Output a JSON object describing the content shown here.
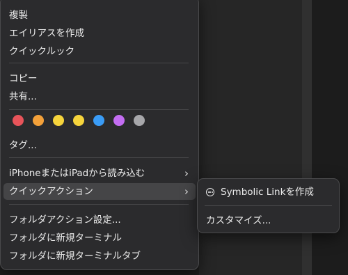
{
  "menu": {
    "items_top": [
      "複製",
      "エイリアスを作成",
      "クイックルック"
    ],
    "items_copy": [
      "コピー",
      "共有..."
    ],
    "tag_colors": [
      "#e8545a",
      "#f3a13a",
      "#f6d43c",
      "#f6d43c",
      "#3a9cf6",
      "#c36df2",
      "#a7a7aa"
    ],
    "tags_label": "タグ...",
    "iphone_import": "iPhoneまたはiPadから読み込む",
    "quick_actions": "クイックアクション",
    "folder_items": [
      "フォルダアクション設定...",
      "フォルダに新規ターミナル",
      "フォルダに新規ターミナルタブ"
    ]
  },
  "submenu": {
    "items": [
      "Symbolic Linkを作成",
      "カスタマイズ..."
    ]
  }
}
